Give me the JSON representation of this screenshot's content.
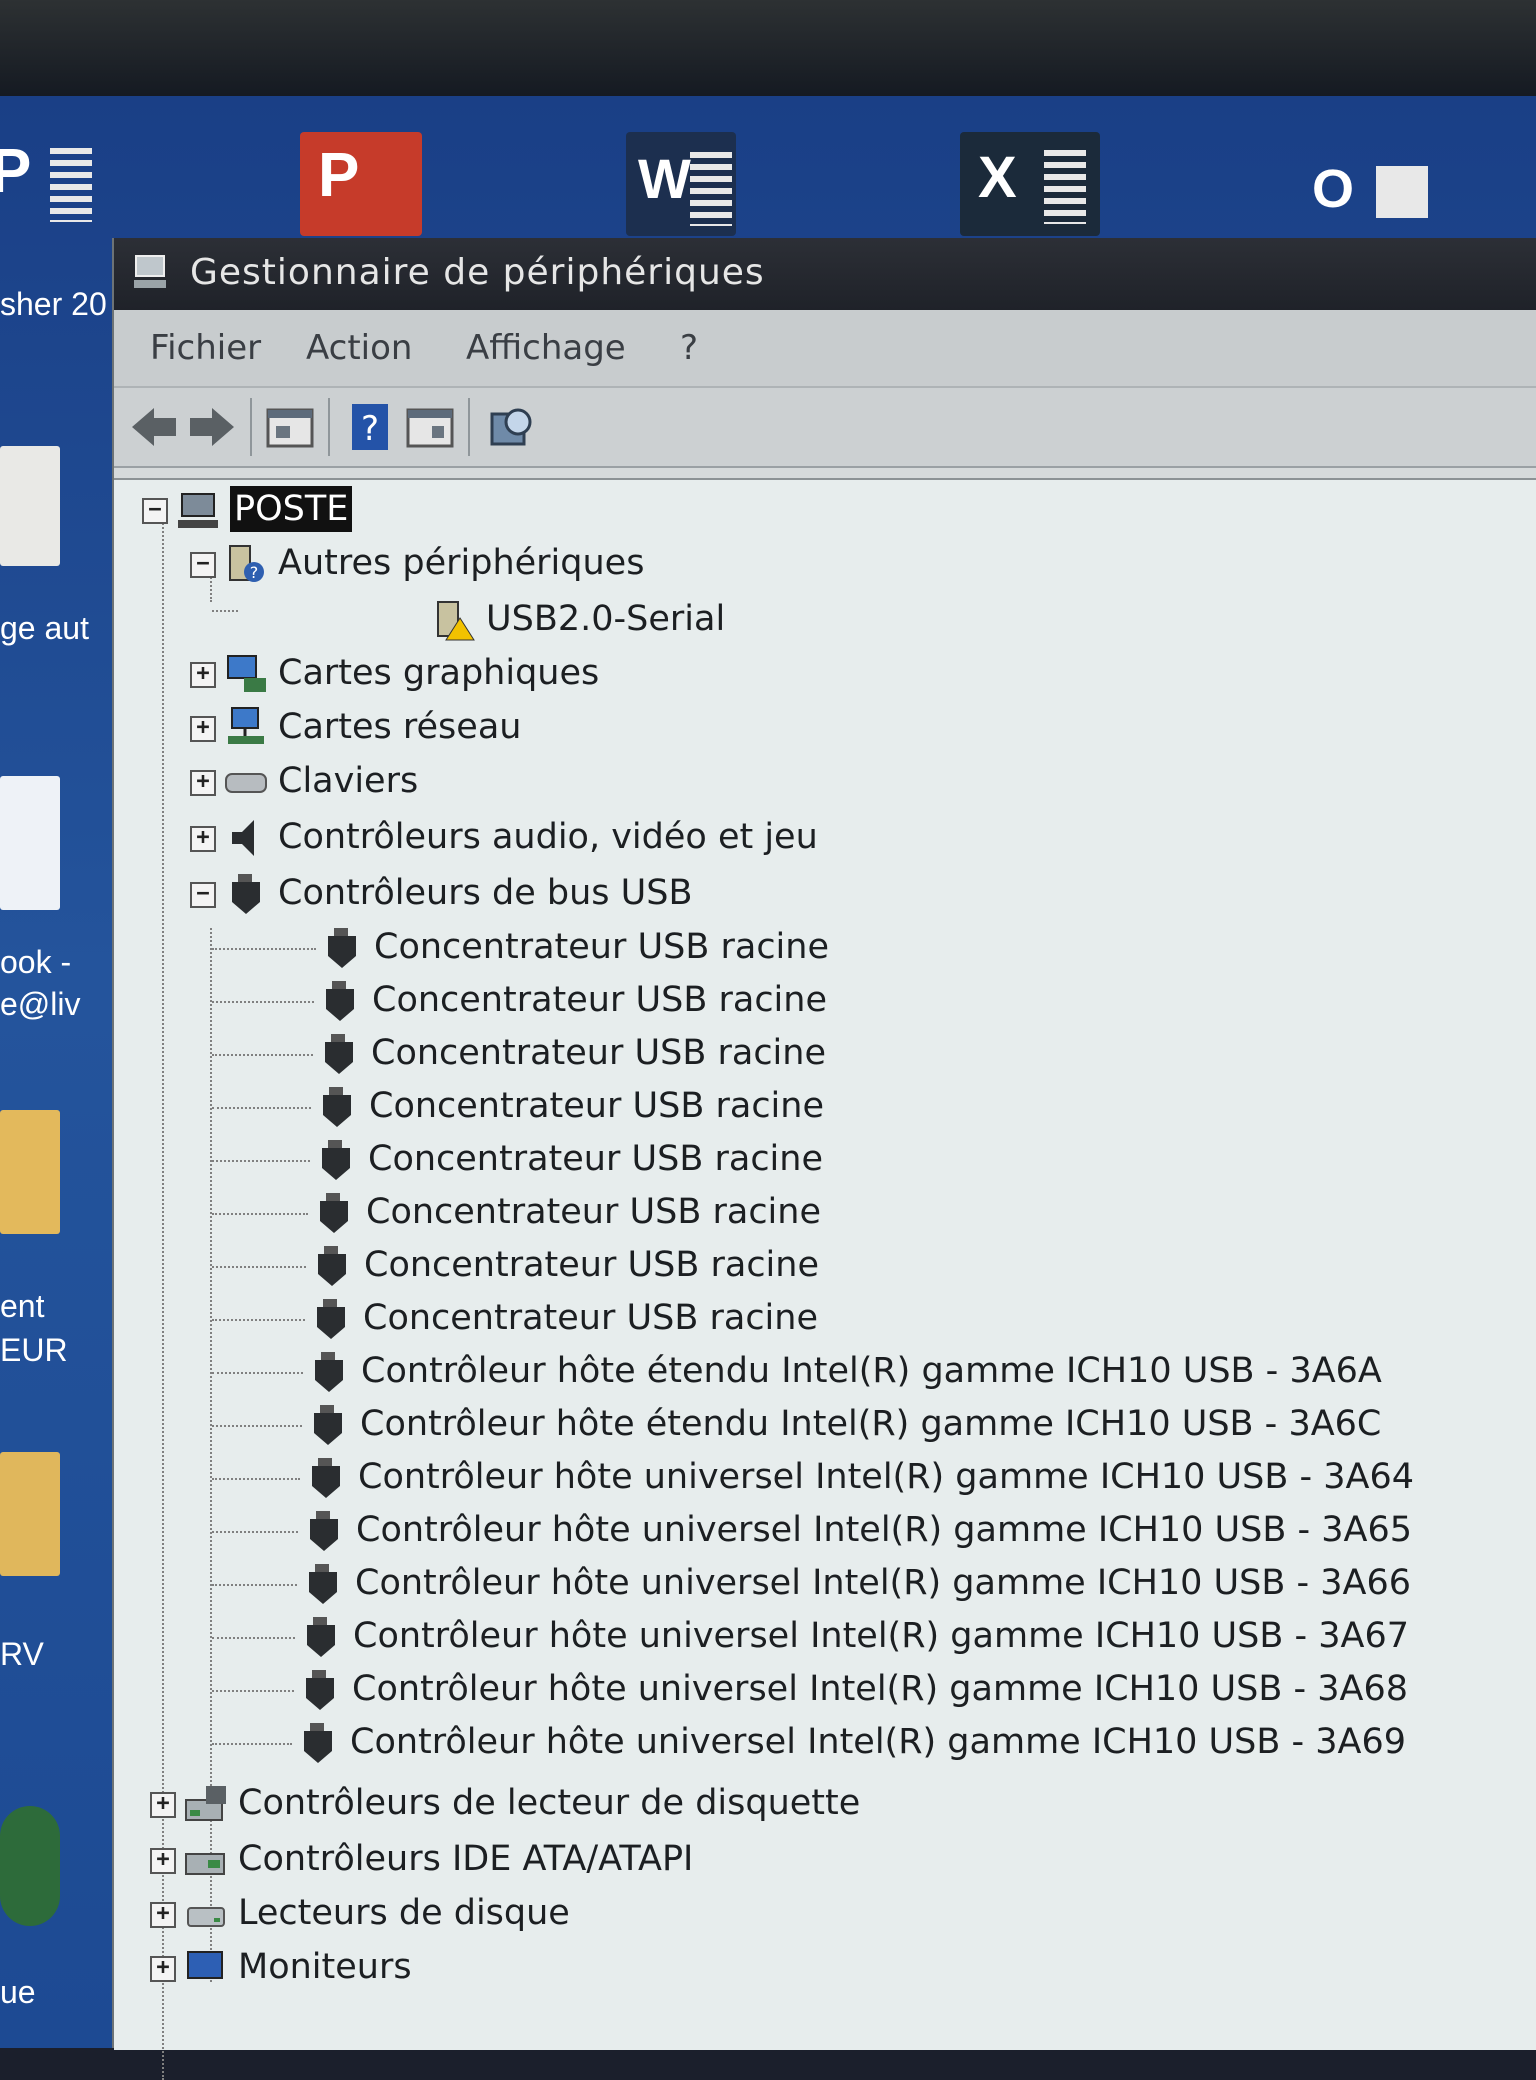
{
  "desktop": {
    "tiles": [
      {
        "letter": "P",
        "color": "#3a5a8c"
      },
      {
        "letter": "P",
        "color": "#c63b2a"
      },
      {
        "letter": "W",
        "color": "#2b579a"
      },
      {
        "letter": "X",
        "color": "#1e7145"
      },
      {
        "letter": "O",
        "color": "#0072c6"
      }
    ],
    "side_labels": [
      "sher 20",
      "ge aut",
      "ook -",
      "e@liv",
      "ent",
      "EUR",
      "RV",
      "ue"
    ]
  },
  "window": {
    "title": "Gestionnaire de périphériques",
    "menu": [
      "Fichier",
      "Action",
      "Affichage",
      "?"
    ],
    "toolbar": [
      "back-icon",
      "forward-icon",
      "properties-icon",
      "help-icon",
      "view-icon",
      "scan-icon"
    ]
  },
  "tree": {
    "root": "POSTE",
    "autres": "Autres périphériques",
    "usb_serial": "USB2.0-Serial",
    "cartes_graphiques": "Cartes graphiques",
    "cartes_reseau": "Cartes réseau",
    "claviers": "Claviers",
    "audio": "Contrôleurs audio, vidéo et jeu",
    "usb_bus": "Contrôleurs de bus USB",
    "usb_children": [
      "Concentrateur USB racine",
      "Concentrateur USB racine",
      "Concentrateur USB racine",
      "Concentrateur USB racine",
      "Concentrateur USB racine",
      "Concentrateur USB racine",
      "Concentrateur USB racine",
      "Concentrateur USB racine",
      "Contrôleur hôte étendu Intel(R) gamme ICH10 USB - 3A6A",
      "Contrôleur hôte étendu Intel(R) gamme ICH10 USB - 3A6C",
      "Contrôleur hôte universel Intel(R) gamme ICH10 USB - 3A64",
      "Contrôleur hôte universel Intel(R) gamme ICH10 USB - 3A65",
      "Contrôleur hôte universel Intel(R) gamme ICH10 USB - 3A66",
      "Contrôleur hôte universel Intel(R) gamme ICH10 USB - 3A67",
      "Contrôleur hôte universel Intel(R) gamme ICH10 USB - 3A68",
      "Contrôleur hôte universel Intel(R) gamme ICH10 USB - 3A69"
    ],
    "disquette": "Contrôleurs de lecteur de disquette",
    "ide": "Contrôleurs IDE ATA/ATAPI",
    "disque": "Lecteurs de disque",
    "moniteurs": "Moniteurs"
  },
  "expanders": {
    "expanded": "−",
    "collapsed": "+"
  }
}
